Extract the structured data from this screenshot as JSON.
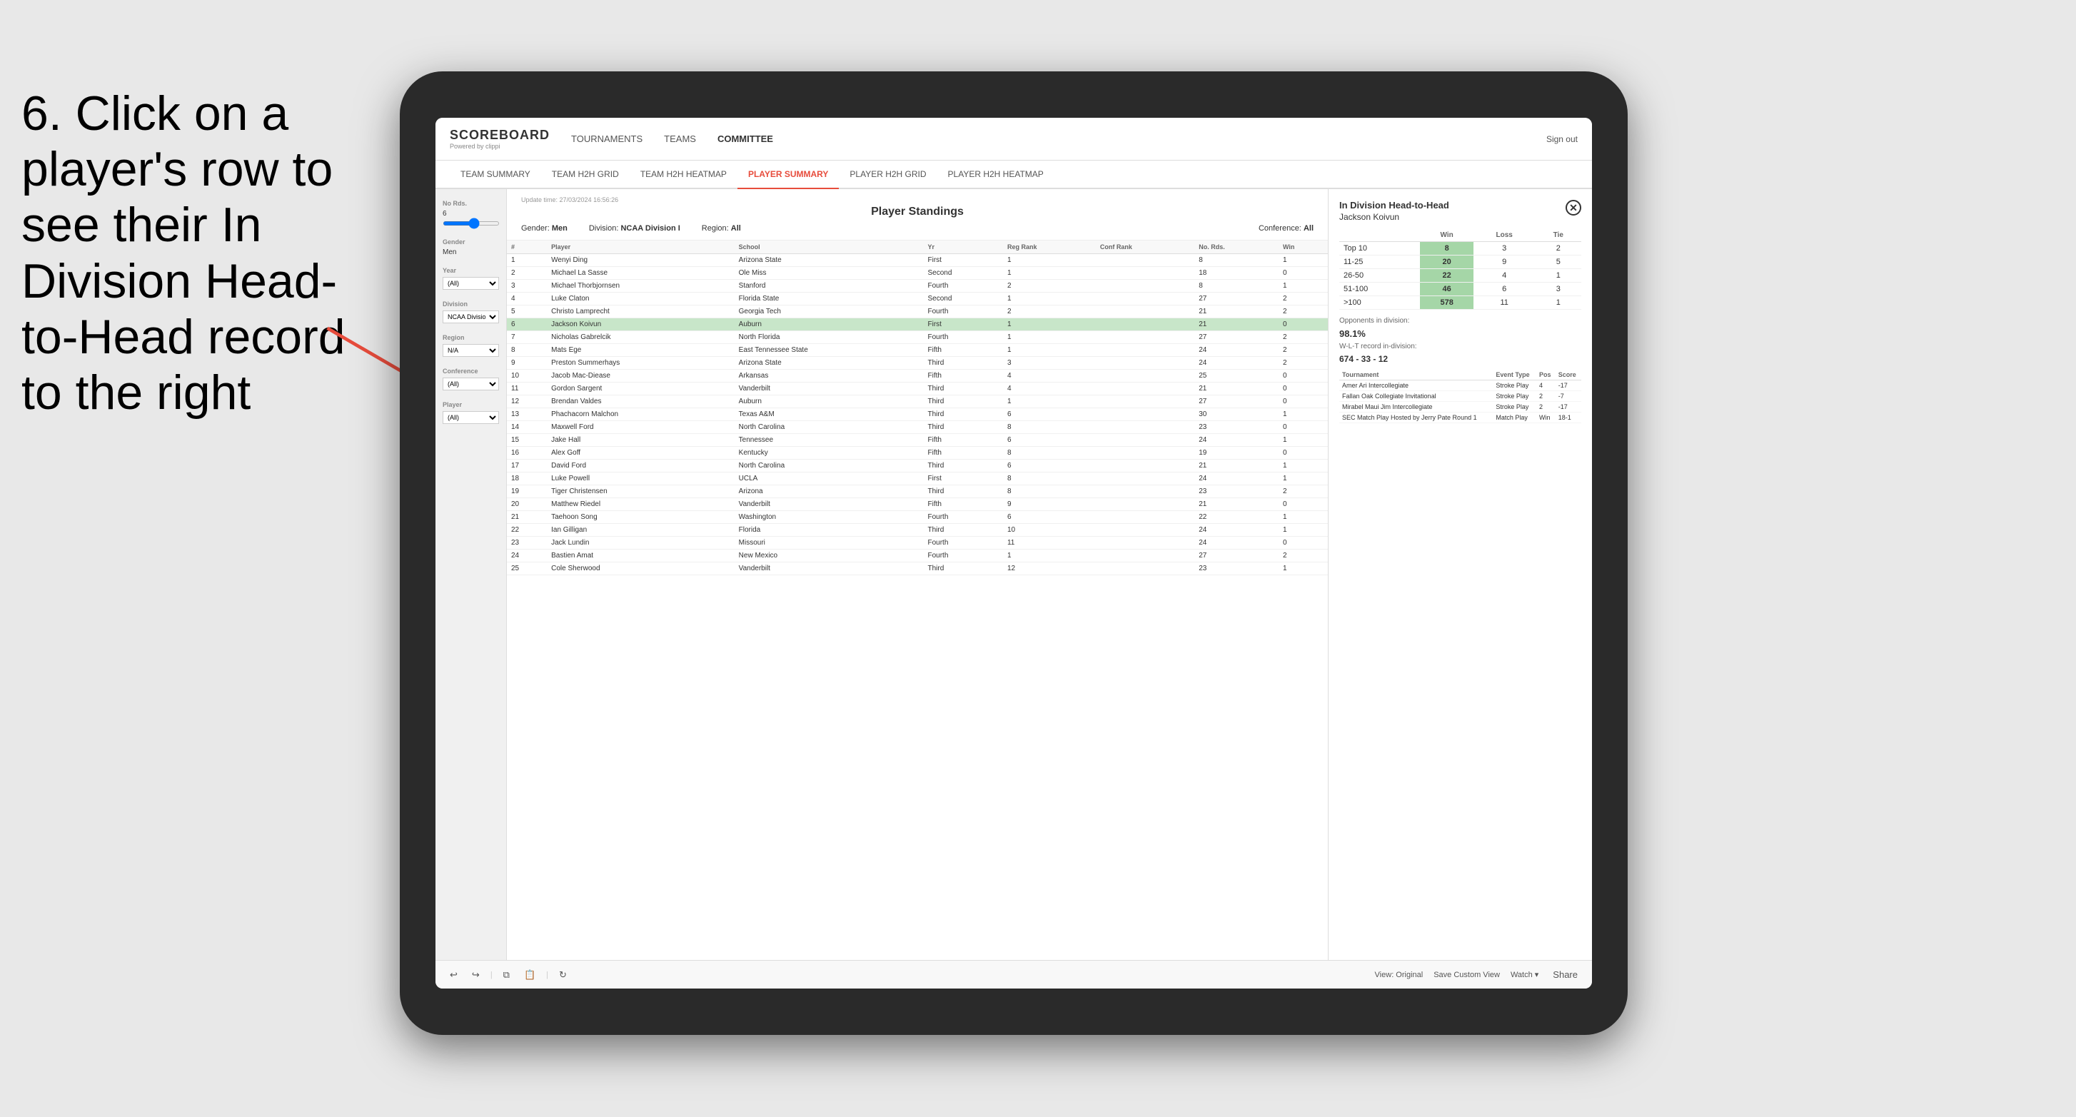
{
  "instruction": {
    "text": "6. Click on a player's row to see their In Division Head-to-Head record to the right"
  },
  "nav": {
    "logo": "SCOREBOARD",
    "logo_sub": "Powered by clippi",
    "items": [
      "TOURNAMENTS",
      "TEAMS",
      "COMMITTEE"
    ],
    "sign_out": "Sign out"
  },
  "sub_nav": {
    "items": [
      "TEAM SUMMARY",
      "TEAM H2H GRID",
      "TEAM H2H HEATMAP",
      "PLAYER SUMMARY",
      "PLAYER H2H GRID",
      "PLAYER H2H HEATMAP"
    ],
    "active": "PLAYER SUMMARY"
  },
  "sidebar": {
    "no_rds_label": "No Rds.",
    "no_rds_value": "6",
    "gender_label": "Gender",
    "gender_value": "Men",
    "year_label": "Year",
    "year_value": "(All)",
    "division_label": "Division",
    "division_value": "NCAA Division I",
    "region_label": "Region",
    "region_value": "N/A",
    "conference_label": "Conference",
    "conference_value": "(All)",
    "player_label": "Player",
    "player_value": "(All)"
  },
  "standings": {
    "update_time": "Update time: 27/03/2024 16:56:26",
    "title": "Player Standings",
    "filters": {
      "gender_label": "Gender:",
      "gender_value": "Men",
      "division_label": "Division:",
      "division_value": "NCAA Division I",
      "region_label": "Region:",
      "region_value": "All",
      "conference_label": "Conference:",
      "conference_value": "All"
    },
    "columns": [
      "#",
      "Player",
      "School",
      "Yr",
      "Reg Rank",
      "Conf Rank",
      "No. Rds.",
      "Win"
    ],
    "rows": [
      {
        "num": 1,
        "player": "Wenyi Ding",
        "school": "Arizona State",
        "yr": "First",
        "reg_rank": 1,
        "conf_rank": "",
        "no_rds": 8,
        "win": 1
      },
      {
        "num": 2,
        "player": "Michael La Sasse",
        "school": "Ole Miss",
        "yr": "Second",
        "reg_rank": 1,
        "conf_rank": "",
        "no_rds": 18,
        "win": 0
      },
      {
        "num": 3,
        "player": "Michael Thorbjornsen",
        "school": "Stanford",
        "yr": "Fourth",
        "reg_rank": 2,
        "conf_rank": "",
        "no_rds": 8,
        "win": 1
      },
      {
        "num": 4,
        "player": "Luke Claton",
        "school": "Florida State",
        "yr": "Second",
        "reg_rank": 1,
        "conf_rank": "",
        "no_rds": 27,
        "win": 2
      },
      {
        "num": 5,
        "player": "Christo Lamprecht",
        "school": "Georgia Tech",
        "yr": "Fourth",
        "reg_rank": 2,
        "conf_rank": "",
        "no_rds": 21,
        "win": 2
      },
      {
        "num": 6,
        "player": "Jackson Koivun",
        "school": "Auburn",
        "yr": "First",
        "reg_rank": 1,
        "conf_rank": "",
        "no_rds": 21,
        "win": 0,
        "highlighted": true
      },
      {
        "num": 7,
        "player": "Nicholas Gabrelcik",
        "school": "North Florida",
        "yr": "Fourth",
        "reg_rank": 1,
        "conf_rank": "",
        "no_rds": 27,
        "win": 2
      },
      {
        "num": 8,
        "player": "Mats Ege",
        "school": "East Tennessee State",
        "yr": "Fifth",
        "reg_rank": 1,
        "conf_rank": "",
        "no_rds": 24,
        "win": 2
      },
      {
        "num": 9,
        "player": "Preston Summerhays",
        "school": "Arizona State",
        "yr": "Third",
        "reg_rank": 3,
        "conf_rank": "",
        "no_rds": 24,
        "win": 2
      },
      {
        "num": 10,
        "player": "Jacob Mac-Diease",
        "school": "Arkansas",
        "yr": "Fifth",
        "reg_rank": 4,
        "conf_rank": "",
        "no_rds": 25,
        "win": 0
      },
      {
        "num": 11,
        "player": "Gordon Sargent",
        "school": "Vanderbilt",
        "yr": "Third",
        "reg_rank": 4,
        "conf_rank": "",
        "no_rds": 21,
        "win": 0
      },
      {
        "num": 12,
        "player": "Brendan Valdes",
        "school": "Auburn",
        "yr": "Third",
        "reg_rank": 1,
        "conf_rank": "",
        "no_rds": 27,
        "win": 0
      },
      {
        "num": 13,
        "player": "Phachacorn Malchon",
        "school": "Texas A&M",
        "yr": "Third",
        "reg_rank": 6,
        "conf_rank": "",
        "no_rds": 30,
        "win": 1
      },
      {
        "num": 14,
        "player": "Maxwell Ford",
        "school": "North Carolina",
        "yr": "Third",
        "reg_rank": 8,
        "conf_rank": "",
        "no_rds": 23,
        "win": 0
      },
      {
        "num": 15,
        "player": "Jake Hall",
        "school": "Tennessee",
        "yr": "Fifth",
        "reg_rank": 6,
        "conf_rank": "",
        "no_rds": 24,
        "win": 1
      },
      {
        "num": 16,
        "player": "Alex Goff",
        "school": "Kentucky",
        "yr": "Fifth",
        "reg_rank": 8,
        "conf_rank": "",
        "no_rds": 19,
        "win": 0
      },
      {
        "num": 17,
        "player": "David Ford",
        "school": "North Carolina",
        "yr": "Third",
        "reg_rank": 6,
        "conf_rank": "",
        "no_rds": 21,
        "win": 1
      },
      {
        "num": 18,
        "player": "Luke Powell",
        "school": "UCLA",
        "yr": "First",
        "reg_rank": 8,
        "conf_rank": "",
        "no_rds": 24,
        "win": 1
      },
      {
        "num": 19,
        "player": "Tiger Christensen",
        "school": "Arizona",
        "yr": "Third",
        "reg_rank": 8,
        "conf_rank": "",
        "no_rds": 23,
        "win": 2
      },
      {
        "num": 20,
        "player": "Matthew Riedel",
        "school": "Vanderbilt",
        "yr": "Fifth",
        "reg_rank": 9,
        "conf_rank": "",
        "no_rds": 21,
        "win": 0
      },
      {
        "num": 21,
        "player": "Taehoon Song",
        "school": "Washington",
        "yr": "Fourth",
        "reg_rank": 6,
        "conf_rank": "",
        "no_rds": 22,
        "win": 1
      },
      {
        "num": 22,
        "player": "Ian Gilligan",
        "school": "Florida",
        "yr": "Third",
        "reg_rank": 10,
        "conf_rank": "",
        "no_rds": 24,
        "win": 1
      },
      {
        "num": 23,
        "player": "Jack Lundin",
        "school": "Missouri",
        "yr": "Fourth",
        "reg_rank": 11,
        "conf_rank": "",
        "no_rds": 24,
        "win": 0
      },
      {
        "num": 24,
        "player": "Bastien Amat",
        "school": "New Mexico",
        "yr": "Fourth",
        "reg_rank": 1,
        "conf_rank": "",
        "no_rds": 27,
        "win": 2
      },
      {
        "num": 25,
        "player": "Cole Sherwood",
        "school": "Vanderbilt",
        "yr": "Third",
        "reg_rank": 12,
        "conf_rank": "",
        "no_rds": 23,
        "win": 1
      }
    ]
  },
  "h2h": {
    "title": "In Division Head-to-Head",
    "player": "Jackson Koivun",
    "table_headers": [
      "",
      "Win",
      "Loss",
      "Tie"
    ],
    "rows": [
      {
        "range": "Top 10",
        "win": 8,
        "loss": 3,
        "tie": 2
      },
      {
        "range": "11-25",
        "win": 20,
        "loss": 9,
        "tie": 5
      },
      {
        "range": "26-50",
        "win": 22,
        "loss": 4,
        "tie": 1
      },
      {
        "range": "51-100",
        "win": 46,
        "loss": 6,
        "tie": 3
      },
      {
        "range": ">100",
        "win": 578,
        "loss": 11,
        "tie": 1
      }
    ],
    "opponents_label": "Opponents in division:",
    "wlt_label": "W-L-T record in-division:",
    "percentage": "98.1%",
    "record": "674 - 33 - 12",
    "tournament_headers": [
      "Tournament",
      "Event Type",
      "Pos",
      "Score"
    ],
    "tournaments": [
      {
        "name": "Amer Ari Intercollegiate",
        "type": "Stroke Play",
        "pos": 4,
        "score": "-17"
      },
      {
        "name": "Fallan Oak Collegiate Invitational",
        "type": "Stroke Play",
        "pos": 2,
        "score": "-7"
      },
      {
        "name": "Mirabel Maui Jim Intercollegiate",
        "type": "Stroke Play",
        "pos": 2,
        "score": "-17"
      },
      {
        "name": "SEC Match Play Hosted by Jerry Pate Round 1",
        "type": "Match Play",
        "pos": "Win",
        "score": "18-1"
      }
    ]
  },
  "toolbar": {
    "view_original": "View: Original",
    "save_custom": "Save Custom View",
    "watch": "Watch ▾",
    "share": "Share"
  }
}
